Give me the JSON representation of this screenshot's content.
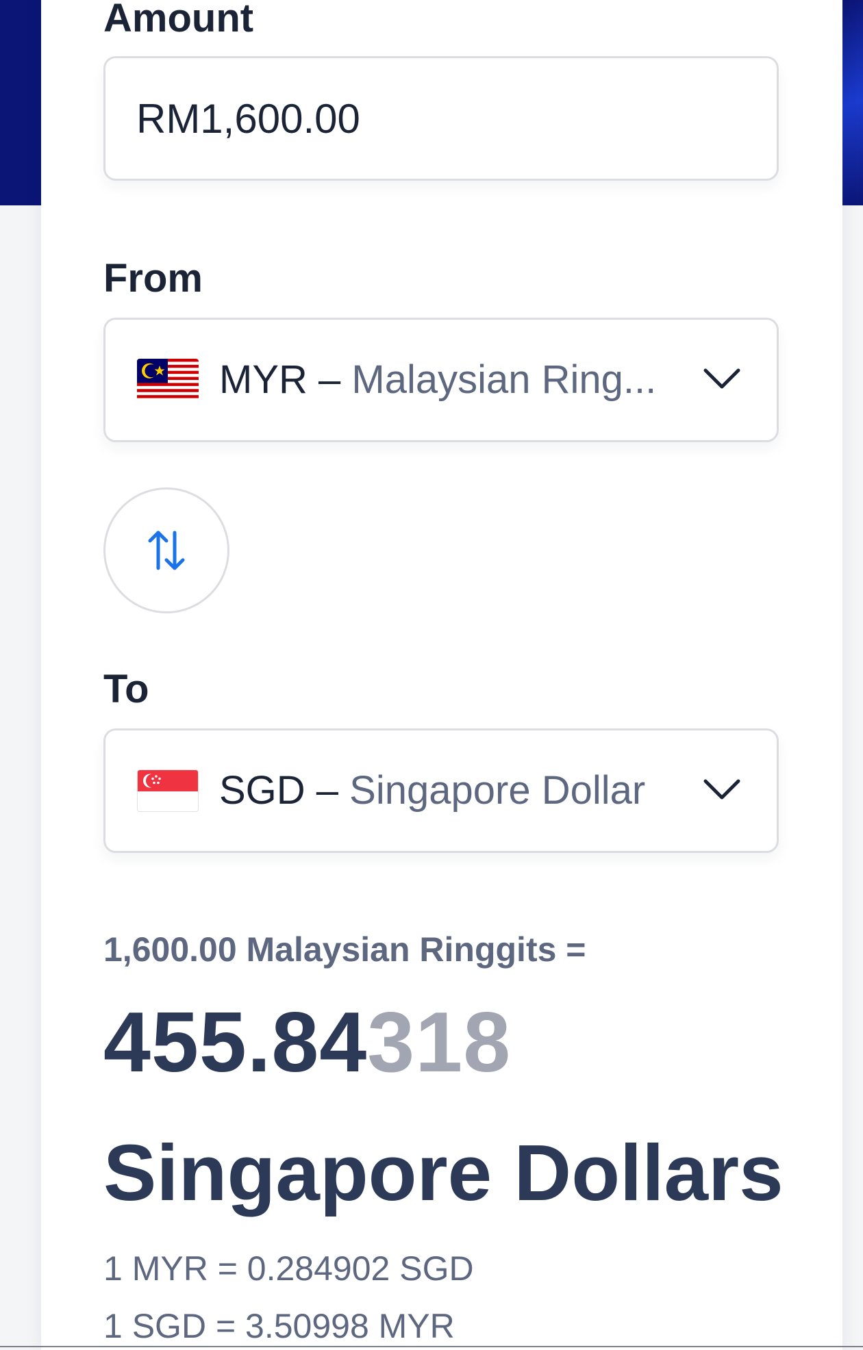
{
  "amount": {
    "label": "Amount",
    "value": "RM1,600.00"
  },
  "from": {
    "label": "From",
    "code": "MYR – ",
    "name": "Malaysian Ring...",
    "flag": "malaysia-flag"
  },
  "swap": {
    "icon": "swap-arrows-icon"
  },
  "to": {
    "label": "To",
    "code": "SGD – ",
    "name": "Singapore Dollar",
    "flag": "singapore-flag"
  },
  "result": {
    "summary": "1,600.00 Malaysian Ringgits =",
    "value_main": "455.84",
    "value_rest": "318",
    "currency_name": "Singapore Dollars",
    "rate_forward": "1 MYR = 0.284902 SGD",
    "rate_reverse": "1 SGD = 3.50998 MYR"
  },
  "colors": {
    "header_band": "#0b1575",
    "accent_blue": "#1a73e8",
    "text_dark": "#1b2336",
    "text_muted": "#5d6780",
    "text_faded": "#a2a6b2"
  }
}
